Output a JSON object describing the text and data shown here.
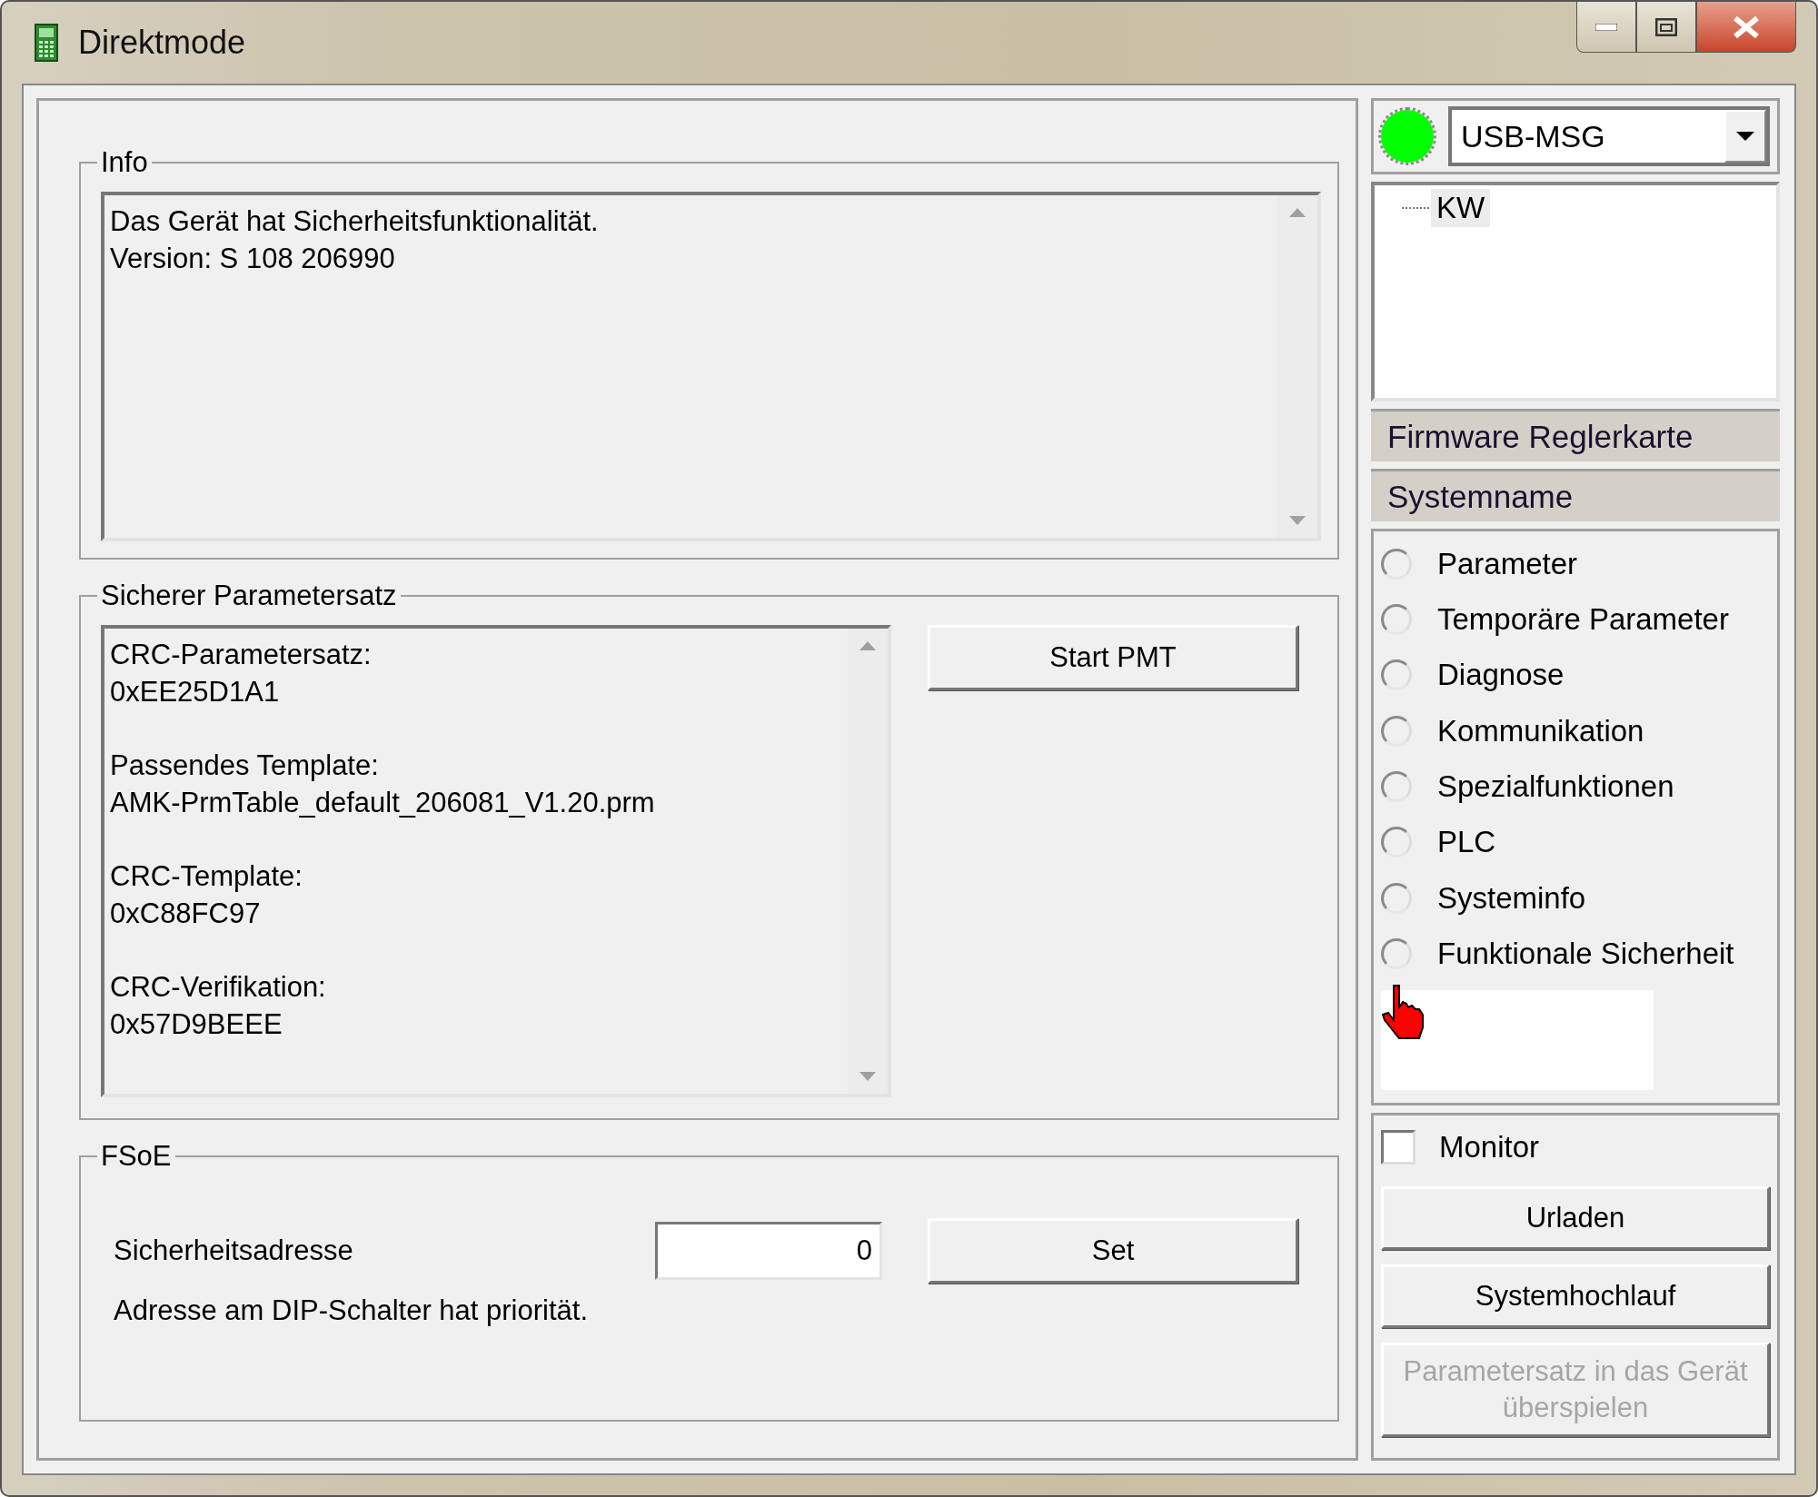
{
  "window": {
    "title": "Direktmode"
  },
  "info": {
    "title": "Info",
    "lines": [
      "Das Gerät hat Sicherheitsfunktionalität.",
      "Version: S 108 206990"
    ]
  },
  "sicherer_parametersatz": {
    "title": "Sicherer Parametersatz",
    "entries": [
      {
        "label": "CRC-Parametersatz:",
        "value": "0xEE25D1A1"
      },
      {
        "label": "Passendes Template:",
        "value": "AMK-PrmTable_default_206081_V1.20.prm"
      },
      {
        "label": "CRC-Template:",
        "value": "0xC88FC97"
      },
      {
        "label": "CRC-Verifikation:",
        "value": "0x57D9BEEE"
      }
    ],
    "button": "Start PMT"
  },
  "fsoe": {
    "title": "FSoE",
    "address_label": "Sicherheitsadresse",
    "address_value": "0",
    "button": "Set",
    "note": "Adresse am DIP-Schalter hat priorität."
  },
  "connection": {
    "status_dot": {
      "color": "#00ff00"
    },
    "interface": "USB-MSG"
  },
  "tree": {
    "items": [
      {
        "label": "KW",
        "selected": true
      }
    ]
  },
  "headers": [
    "Firmware Reglerkarte",
    "Systemname"
  ],
  "views": [
    {
      "label": "Parameter",
      "selected": false
    },
    {
      "label": "Temporäre Parameter",
      "selected": false
    },
    {
      "label": "Diagnose",
      "selected": false
    },
    {
      "label": "Kommunikation",
      "selected": false
    },
    {
      "label": "Spezialfunktionen",
      "selected": false
    },
    {
      "label": "PLC",
      "selected": false
    },
    {
      "label": "Systeminfo",
      "selected": false
    },
    {
      "label": "Funktionale Sicherheit",
      "selected": false
    }
  ],
  "monitor": {
    "label": "Monitor",
    "checked": false
  },
  "actions": [
    {
      "label": "Urladen",
      "disabled": false
    },
    {
      "label": "Systemhochlauf",
      "disabled": false
    },
    {
      "label": "Parametersatz in das Gerät überspielen",
      "disabled": true
    }
  ]
}
